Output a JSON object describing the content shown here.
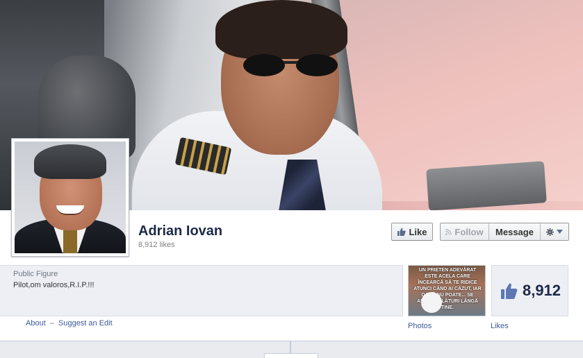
{
  "profile": {
    "name": "Adrian Iovan",
    "likes_line": "8,912 likes"
  },
  "actions": {
    "like_label": "Like",
    "follow_label": "Follow",
    "message_label": "Message"
  },
  "info": {
    "category": "Public Figure",
    "description": "Pilot,om valoros,R.I.P.!!!",
    "about_link": "About",
    "separator": "–",
    "suggest_edit_link": "Suggest an Edit"
  },
  "apps": {
    "photos_label": "Photos",
    "photos_thumb_caption": "UN PRIETEN ADEVĂRAT ESTE ACELA CARE ÎNCEARCĂ SĂ TE RIDICE ATUNCI CÂND AI CĂZUT, IAR DACĂ NU POATE... SE AȘEAZĂ ALĂTURI LÂNGĂ TINE.",
    "likes_label": "Likes",
    "likes_count": "8,912"
  },
  "colors": {
    "link": "#3b5998",
    "name": "#1c2a47",
    "panel_bg": "#edeff4"
  },
  "icons": {
    "like": "thumbs-up-icon",
    "follow": "rss-icon",
    "settings": "gear-icon",
    "dropdown": "caret-down-icon"
  }
}
